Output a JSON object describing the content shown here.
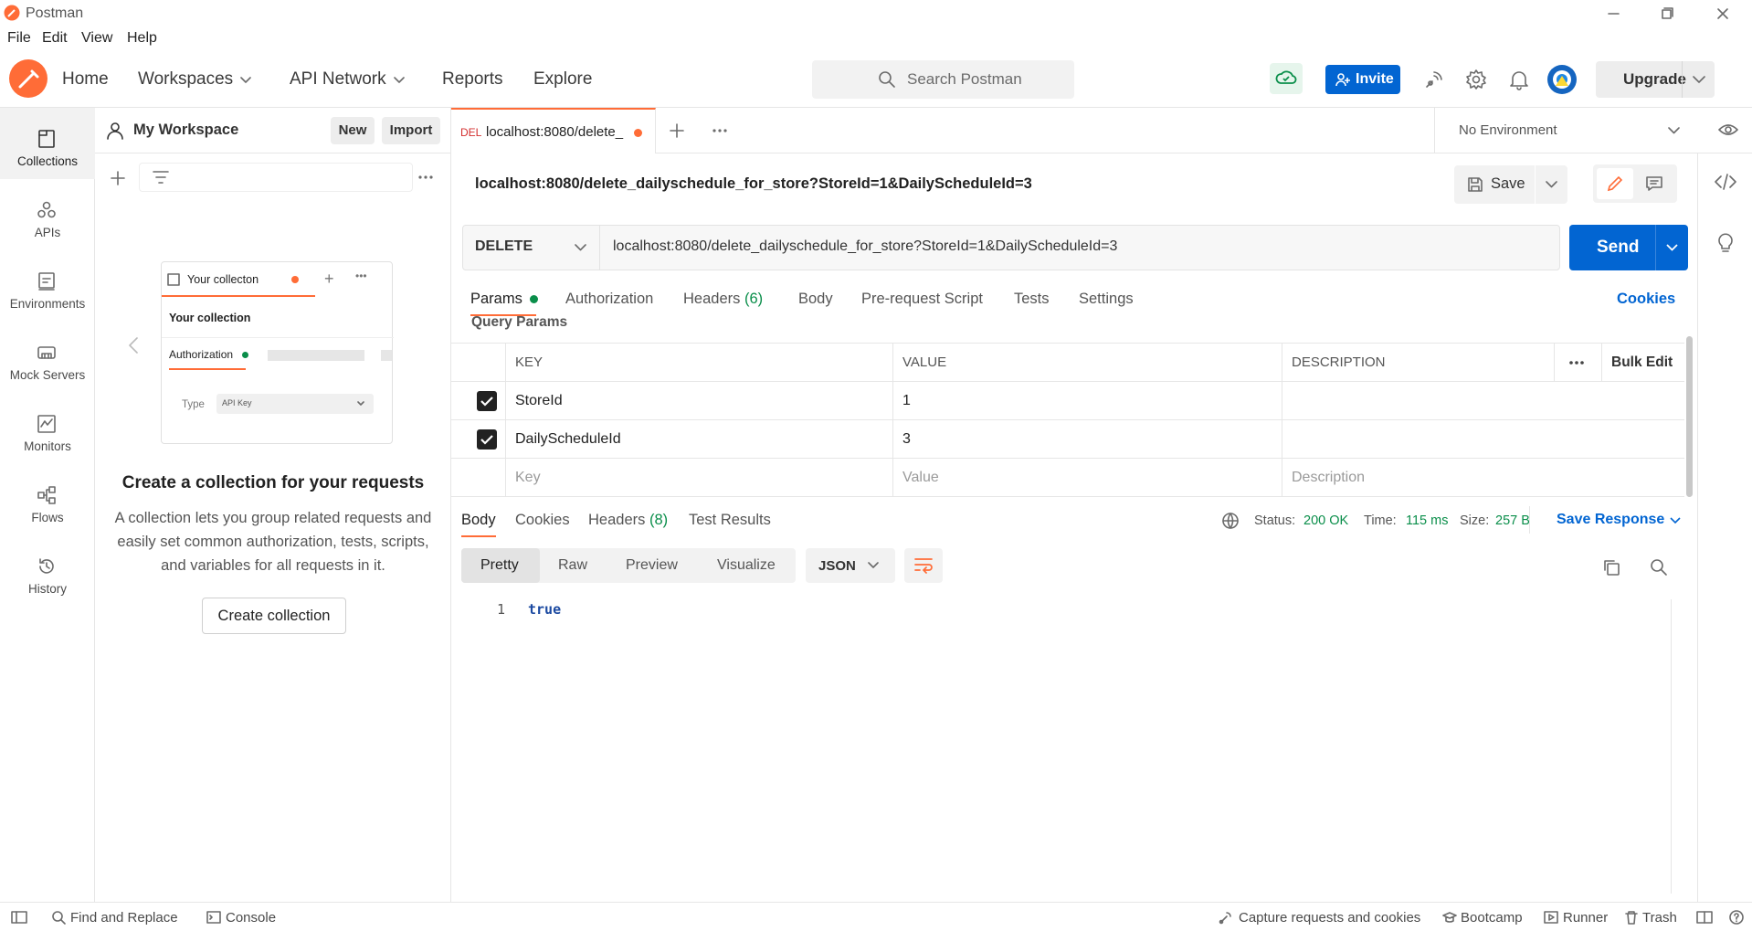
{
  "window": {
    "title": "Postman"
  },
  "menu": [
    "File",
    "Edit",
    "View",
    "Help"
  ],
  "nav": {
    "home": "Home",
    "workspaces": "Workspaces",
    "api_network": "API Network",
    "reports": "Reports",
    "explore": "Explore"
  },
  "search": {
    "placeholder": "Search Postman"
  },
  "header": {
    "invite": "Invite",
    "upgrade": "Upgrade"
  },
  "workspace": {
    "name": "My Workspace",
    "new_label": "New",
    "import_label": "Import"
  },
  "sidebar": {
    "items": [
      {
        "label": "Collections",
        "icon": "collections-icon"
      },
      {
        "label": "APIs",
        "icon": "apis-icon"
      },
      {
        "label": "Environments",
        "icon": "environments-icon"
      },
      {
        "label": "Mock Servers",
        "icon": "mock-servers-icon"
      },
      {
        "label": "Monitors",
        "icon": "monitors-icon"
      },
      {
        "label": "Flows",
        "icon": "flows-icon"
      },
      {
        "label": "History",
        "icon": "history-icon"
      }
    ]
  },
  "empty_state": {
    "illustration": {
      "tab": "Your collecton",
      "title": "Your collection",
      "auth": "Authorization",
      "type_label": "Type",
      "type_value": "API Key"
    },
    "title": "Create a collection for your requests",
    "line1": "A collection lets you group related requests and",
    "line2": "easily set common authorization, tests, scripts,",
    "line3": "and variables for all requests in it.",
    "button": "Create collection"
  },
  "request_tab": {
    "method": "DEL",
    "label": "localhost:8080/delete_"
  },
  "environment": {
    "selected": "No Environment"
  },
  "request": {
    "title": "localhost:8080/delete_dailyschedule_for_store?StoreId=1&DailyScheduleId=3",
    "save": "Save",
    "method": "DELETE",
    "url": "localhost:8080/delete_dailyschedule_for_store?StoreId=1&DailyScheduleId=3",
    "send": "Send",
    "tabs": {
      "params": "Params",
      "authorization": "Authorization",
      "headers": "Headers",
      "headers_count": "(6)",
      "body": "Body",
      "prerequest": "Pre-request Script",
      "tests": "Tests",
      "settings": "Settings"
    },
    "cookies": "Cookies",
    "query_params_label": "Query Params"
  },
  "params": {
    "columns": {
      "key": "KEY",
      "value": "VALUE",
      "description": "DESCRIPTION",
      "bulk_edit": "Bulk Edit"
    },
    "rows": [
      {
        "key": "StoreId",
        "value": "1",
        "checked": true
      },
      {
        "key": "DailyScheduleId",
        "value": "3",
        "checked": true
      }
    ],
    "placeholder": {
      "key": "Key",
      "value": "Value",
      "description": "Description"
    }
  },
  "response": {
    "tabs": {
      "body": "Body",
      "cookies": "Cookies",
      "headers": "Headers",
      "headers_count": "(8)",
      "test_results": "Test Results"
    },
    "status_label": "Status:",
    "status": "200 OK",
    "time_label": "Time:",
    "time": "115 ms",
    "size_label": "Size:",
    "size": "257 B",
    "save_response": "Save Response",
    "views": {
      "pretty": "Pretty",
      "raw": "Raw",
      "preview": "Preview",
      "visualize": "Visualize"
    },
    "format": "JSON",
    "line_number": "1",
    "body": "true"
  },
  "statusbar": {
    "find_replace": "Find and Replace",
    "console": "Console",
    "capture": "Capture requests and cookies",
    "bootcamp": "Bootcamp",
    "runner": "Runner",
    "trash": "Trash"
  },
  "colors": {
    "accent": "#ff6c37",
    "primary": "#0265d2",
    "success": "#0a8e4a"
  }
}
